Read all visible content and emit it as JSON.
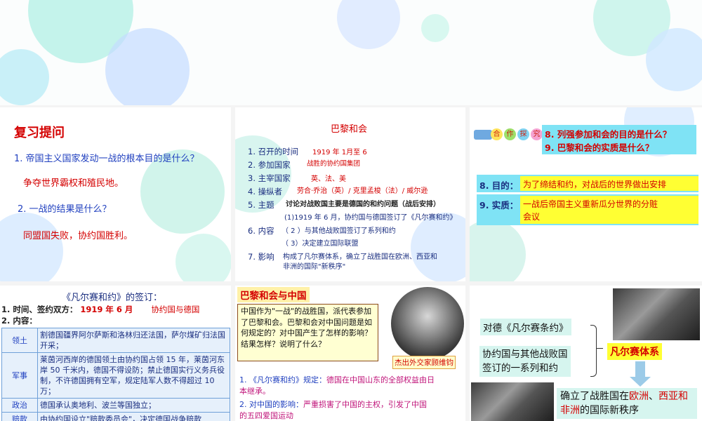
{
  "review": {
    "title": "复习提问",
    "q1": "1. 帝国主义国家发动一战的根本目的是什么？",
    "a1": "争夺世界霸权和殖民地。",
    "q2": "2. 一战的结果是什么？",
    "a2": "同盟国失败，协约国胜利。"
  },
  "paris": {
    "title": "巴黎和会",
    "rows": [
      {
        "label": "1. 召开的时间",
        "value": "1919 年 1月至 6"
      },
      {
        "label": "2. 参加国家",
        "value": "战胜的协约国集团"
      },
      {
        "label": "3. 主宰国家",
        "value": "英、法、美"
      },
      {
        "label": "4. 操纵者",
        "value": "劳合·乔治（英）/ 克里孟梭（法）/ 威尔逊"
      },
      {
        "label": "5. 主题",
        "value": "讨论对战败国主要是德国的和约问题（战后安排）"
      }
    ],
    "content_label": "6. 内容",
    "content_items": [
      "(1)1919 年 6 月，协约国与德国签订了《凡尔赛和约》",
      "（ 2 ）与其他战败国签订了系列和约",
      "（ 3）决定建立国际联盟"
    ],
    "impact_label": "7. 影响",
    "impact_text1": "构成了凡尔赛体系，确立了战胜国在欧洲、西亚和",
    "impact_text2": "非洲的国际\"新秩序\""
  },
  "coop": {
    "chars": [
      "合",
      "作",
      "探",
      "究"
    ],
    "q8": "8. 列强参加和会的目的是什么？",
    "q9": "9. 巴黎和会的实质是什么？",
    "a8_label": "8. 目的：",
    "a8": "为了缔结和约，对战后的世界做出安排",
    "a9_label": "9. 实质：",
    "a9_line1": "一战后帝国主义重新瓜分世界的分赃",
    "a9_line2": "会议"
  },
  "treaty": {
    "title": "《凡尔赛和约》的签订：",
    "line1_label": "1. 时间、签约双方：",
    "line1_date": "1919 年 6 月",
    "line1_parties": "协约国与德国",
    "line2": "2. 内容：",
    "rows": [
      {
        "key": "领土",
        "value": "割德国疆界阿尔萨斯和洛林归还法国，萨尔煤矿归法国开采；"
      },
      {
        "key": "军事",
        "value": "莱茵河西岸的德国领土由协约国占领 15 年，莱茵河东岸 50 千米内，德国不得设防；禁止德国实行义务兵役制，不许德国拥有空军，规定陆军人数不得超过 10 万；"
      },
      {
        "key": "政治",
        "value": "德国承认奥地利、波兰等国独立；"
      },
      {
        "key": "赔款",
        "value": "由协约国设立\"赔款委员会\"，决定德国战争赔款"
      }
    ]
  },
  "china": {
    "title": "巴黎和会与中国",
    "box_text": "中国作为\"一战\"的战胜国，派代表参加了巴黎和会。巴黎和会对中国问题是如何规定的？对中国产生了怎样的影响？结果怎样？说明了什么？",
    "caption": "杰出外交家顾维钧",
    "point1_label": "1. 《凡尔赛和约》规定：",
    "point1_line1": "德国在中国山东的全部权益由日",
    "point1_line2": "本继承。",
    "point2_label": "2. 对中国的影响：",
    "point2_line1": "严重损害了中国的主权，引发了中国",
    "point2_line2": "的五四爱国运动"
  },
  "system": {
    "left1": "对德《凡尔赛条约》",
    "left2_line1": "协约国与其他战败国",
    "left2_line2": "签订的一系列和约",
    "result": "凡尔赛体系",
    "effect_prefix": "确立了战胜国在",
    "effect_europe": "欧洲",
    "effect_sep": "、",
    "effect_west": "西",
    "effect_asia": "亚和非洲",
    "effect_suffix": "的国际新秩序"
  }
}
